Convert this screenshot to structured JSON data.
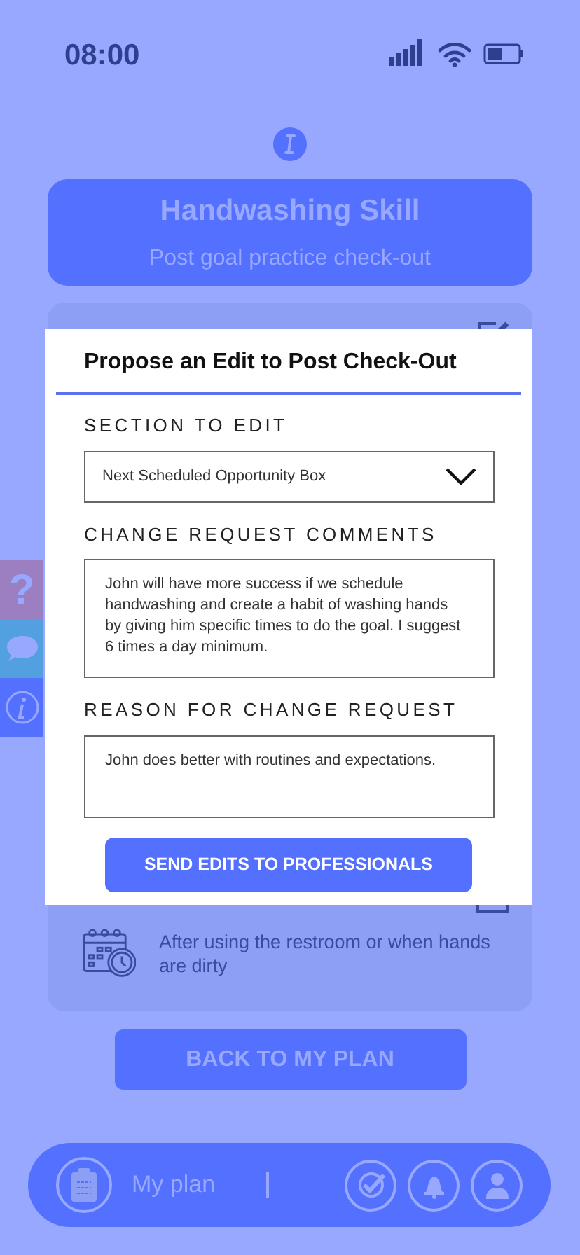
{
  "status_bar": {
    "time": "08:00"
  },
  "header": {
    "title": "Handwashing Skill",
    "subtitle": "Post goal practice check-out"
  },
  "card": {
    "next_text": "After using the restroom or when hands are dirty"
  },
  "side_tabs": [
    {
      "kind": "help",
      "glyph": "?"
    },
    {
      "kind": "chat"
    },
    {
      "kind": "info"
    }
  ],
  "modal": {
    "title": "Propose an Edit to Post Check-Out",
    "fields": [
      {
        "kind": "select",
        "label": "SECTION TO EDIT",
        "value": "Next Scheduled Opportunity Box"
      },
      {
        "kind": "textarea",
        "label": "CHANGE REQUEST COMMENTS",
        "value": "John will have more success if we schedule handwashing and create a habit of washing hands by giving him specific times to do the goal. I suggest 6 times a day minimum."
      },
      {
        "kind": "textarea",
        "label": "REASON FOR CHANGE REQUEST",
        "value": "John does better with routines and expectations."
      }
    ],
    "button": "SEND EDITS TO PROFESSIONALS"
  },
  "back_button": "BACK TO MY PLAN",
  "bottom_nav": {
    "label": "My plan"
  }
}
